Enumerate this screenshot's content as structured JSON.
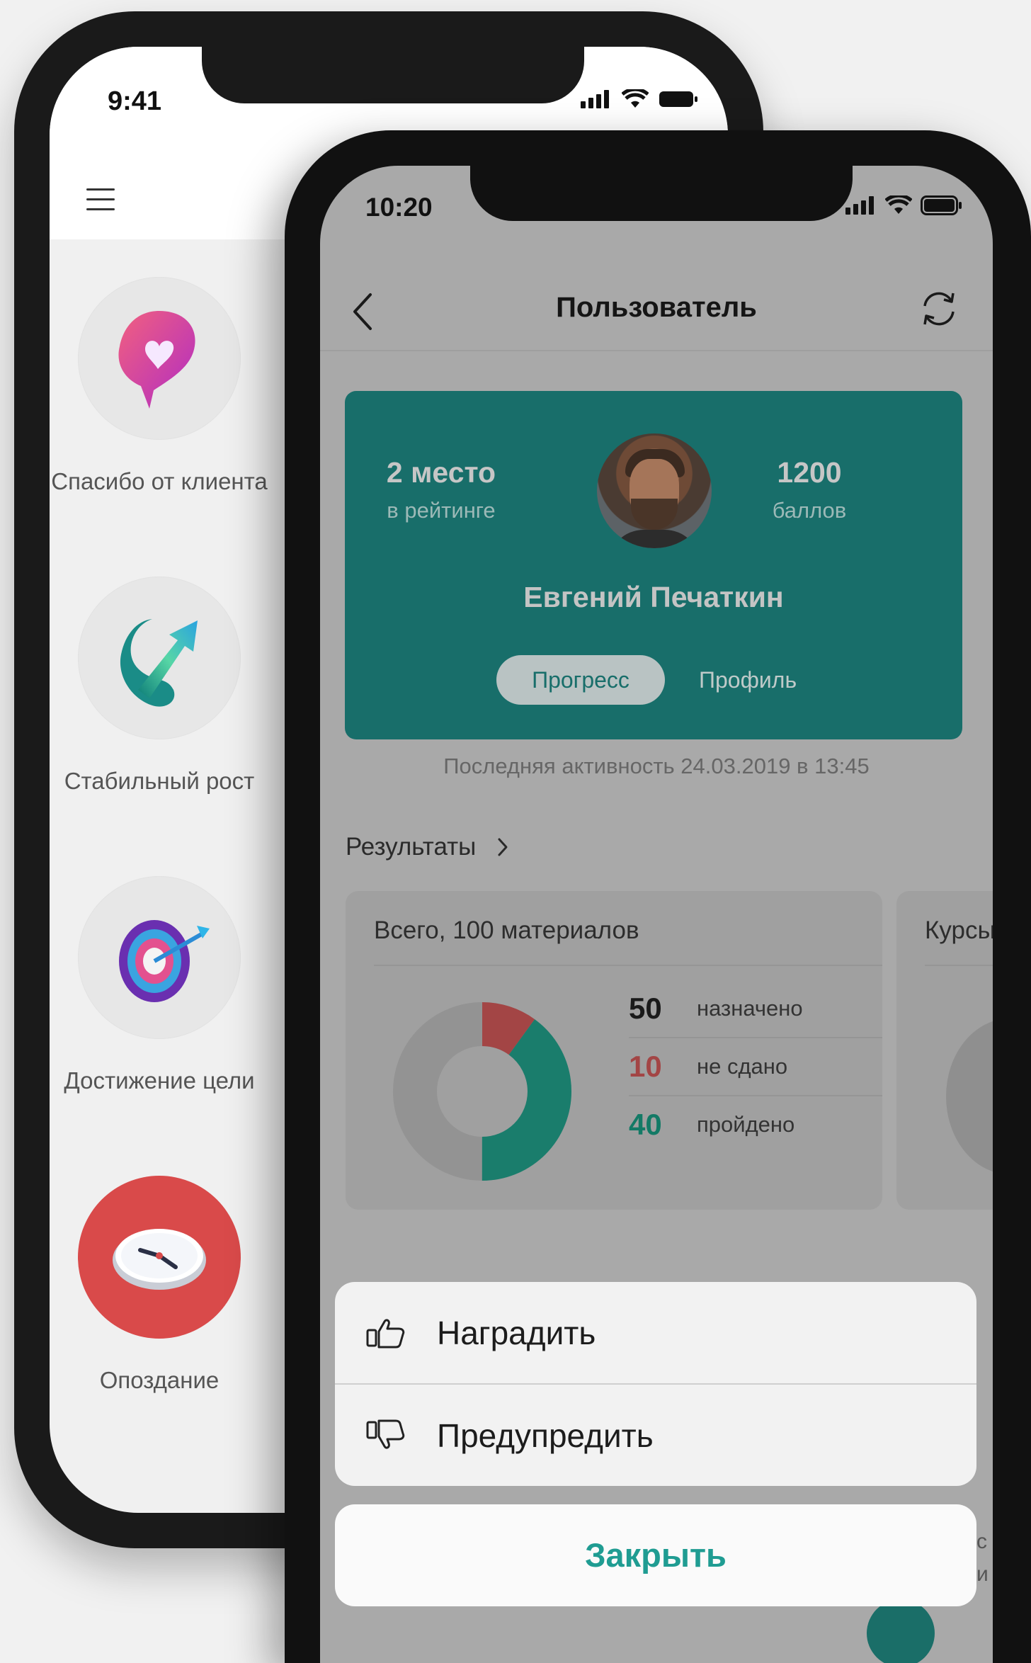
{
  "back_phone": {
    "time": "9:41",
    "achievements": [
      {
        "label": "Спасибо от клиента",
        "icon": "heart-chat-icon"
      },
      {
        "label": "Стабильный рост",
        "icon": "growth-arrow-icon"
      },
      {
        "label": "Достижение цели",
        "icon": "target-icon"
      },
      {
        "label": "Опоздание",
        "icon": "clock-icon"
      }
    ]
  },
  "front_phone": {
    "time": "10:20",
    "nav": {
      "title": "Пользователь"
    },
    "profile": {
      "rank_value": "2 место",
      "rank_sub": "в рейтинге",
      "points_value": "1200",
      "points_sub": "баллов",
      "name": "Евгений Печаткин",
      "tab_progress": "Прогресс",
      "tab_profile": "Профиль"
    },
    "last_activity": "Последняя активность 24.03.2019 в 13:45",
    "results_label": "Результаты",
    "stats": {
      "title": "Всего, 100 материалов",
      "rows": [
        {
          "value": "50",
          "label": "назначено",
          "color": "#1a1a1a"
        },
        {
          "value": "10",
          "label": "не сдано",
          "color": "#c24848"
        },
        {
          "value": "40",
          "label": "пройдено",
          "color": "#1a8c79"
        }
      ]
    },
    "stats2": {
      "title": "Курсы"
    },
    "sheet": {
      "award": "Наградить",
      "warn": "Предупредить",
      "close": "Закрыть"
    },
    "colors": {
      "accent": "#1f9c92",
      "card": "#186e6a",
      "failed": "#c24848",
      "passed": "#1a8c79"
    }
  }
}
